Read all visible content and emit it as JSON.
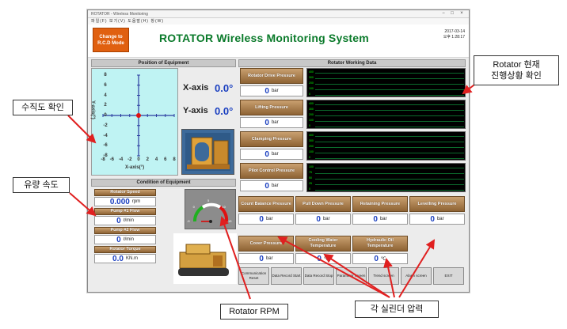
{
  "window": {
    "titlebar": "ROTATOR - Wireless Monitoring",
    "menu": "파일(F)  보기(V)  도움말(H)  창(W)",
    "min": "−",
    "max": "□",
    "close": "×"
  },
  "header": {
    "rcd_button": "Change to R.C.D Mode",
    "title": "ROTATOR Wireless Monitoring System",
    "date": "2017-03-14",
    "time": "오후 1:28:17"
  },
  "position": {
    "heading": "Position of Equipment",
    "ylabel": "Y-axis(°)",
    "xlabel": "X-axis(°)",
    "x_ticks": [
      "-8",
      "-6",
      "-4",
      "-2",
      "0",
      "2",
      "4",
      "6",
      "8"
    ],
    "y_ticks": [
      "8",
      "6",
      "4",
      "2",
      "0",
      "-2",
      "-4",
      "-6",
      "-8"
    ],
    "x_axis_label": "X-axis",
    "x_axis_value": "0.0°",
    "y_axis_label": "Y-axis",
    "y_axis_value": "0.0°",
    "point": {
      "x": 0,
      "y": 0
    }
  },
  "condition": {
    "heading": "Condition of Equipment",
    "items": [
      {
        "label": "Rotator Speed",
        "value": "0.000",
        "unit": "rpm"
      },
      {
        "label": "Pump #1 Flow",
        "value": "0",
        "unit": "ℓ/min"
      },
      {
        "label": "Pump #2 Flow",
        "value": "0",
        "unit": "ℓ/min"
      },
      {
        "label": "Rotator Torque",
        "value": "0.0",
        "unit": "KN.m"
      }
    ]
  },
  "gauge": {
    "ticks": [
      "-5",
      "0",
      "5",
      "10",
      "15"
    ],
    "value": 0
  },
  "working": {
    "heading": "Rotator Working Data",
    "rows": [
      {
        "label": "Rotator Drive Pressure",
        "value": "0",
        "unit": "bar",
        "scale": [
          "400",
          "300",
          "200",
          "100",
          "0"
        ]
      },
      {
        "label": "Lifting Pressure",
        "value": "0",
        "unit": "bar",
        "scale": [
          "400",
          "300",
          "200",
          "100",
          "0"
        ]
      },
      {
        "label": "Clamping Pressure",
        "value": "0",
        "unit": "bar",
        "scale": [
          "400",
          "300",
          "200",
          "100",
          "0"
        ]
      },
      {
        "label": "Pilot Control Pressure",
        "value": "0",
        "unit": "bar",
        "scale": [
          "100",
          "75",
          "50",
          "25",
          "0"
        ]
      }
    ]
  },
  "cylinders": [
    {
      "label": "Count Balance Pressure",
      "value": "0",
      "unit": "bar"
    },
    {
      "label": "Pull Down Pressure",
      "value": "0",
      "unit": "bar"
    },
    {
      "label": "Retaining Pressure",
      "value": "0",
      "unit": "bar"
    },
    {
      "label": "Levelling Pressure",
      "value": "0",
      "unit": "bar"
    },
    {
      "label": "Cover Pressure",
      "value": "0",
      "unit": "bar"
    },
    {
      "label": "Cooling Water Temperature",
      "value": "0",
      "unit": "℃"
    },
    {
      "label": "Hydraulic Oil Temperature",
      "value": "0",
      "unit": "℃"
    }
  ],
  "buttons": [
    "Communication Reset",
    "Data Record Start",
    "Data Record Stop",
    "Parameter screen",
    "Trend screen",
    "Alarm screen",
    "EXIT"
  ],
  "annotations": {
    "verticality": "수직도 확인",
    "flow": "유량 속도",
    "progress": "Rotator 현재\n진행상황 확인",
    "rpm": "Rotator  RPM",
    "cylinder": "각 실린더 압력"
  }
}
